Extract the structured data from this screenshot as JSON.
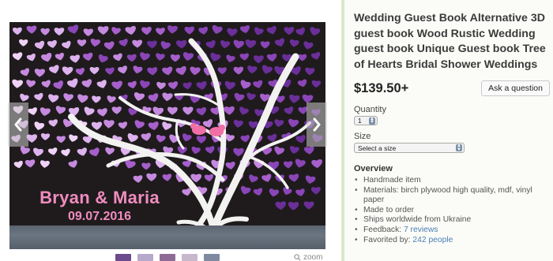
{
  "gallery": {
    "photo": {
      "name_line": "Bryan & Maria",
      "date_line": "09.07.2016"
    },
    "prev_icon": "chevron-left-icon",
    "next_icon": "chevron-right-icon",
    "thumbnail_colors": [
      "#6c4a8e",
      "#b6a9c9",
      "#8d6b95",
      "#c8b8cc",
      "#7f8aa0"
    ],
    "zoom_label": "zoom",
    "zoom_icon": "magnifier-icon"
  },
  "listing": {
    "title": "Wedding Guest Book Alternative 3D guest book Wood Rustic Wedding guest book Unique Guest book Tree of Hearts Bridal Shower Weddings",
    "price": "$139.50+",
    "ask_button": "Ask a question",
    "quantity_label": "Quantity",
    "quantity_value": "1",
    "size_label": "Size",
    "size_value": "Select a size",
    "overview_heading": "Overview",
    "overview_items": {
      "handmade": "Handmade item",
      "materials": "Materials: birch plywood high quality, mdf, vinyl paper",
      "made_to_order": "Made to order",
      "ships": "Ships worldwide from Ukraine",
      "feedback_prefix": "Feedback:",
      "feedback_link": "7 reviews",
      "favorited_prefix": "Favorited by:",
      "favorited_link": "242 people"
    }
  },
  "colors": {
    "accent_divider": "#d8e9c8",
    "link": "#4a80b4",
    "heart_palette": [
      "#6b2f9a",
      "#8a45b7",
      "#a75fcc",
      "#c58adf",
      "#ddb3ee",
      "#f0d2f7"
    ],
    "names_pink": "#f08cbf"
  }
}
